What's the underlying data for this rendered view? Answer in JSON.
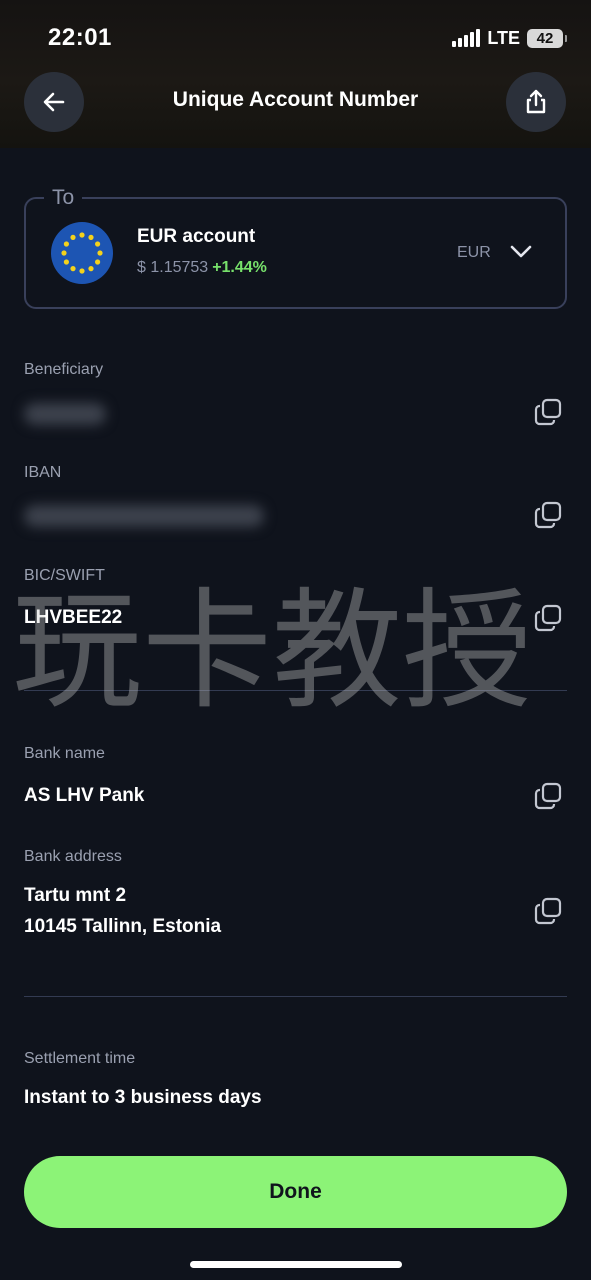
{
  "status_bar": {
    "time": "22:01",
    "network": "LTE",
    "battery": "42"
  },
  "header": {
    "title": "Unique Account Number"
  },
  "to_card": {
    "label": "To",
    "account_name": "EUR account",
    "rate": "$ 1.15753",
    "change": "+1.44%",
    "currency": "EUR"
  },
  "details": {
    "beneficiary_label": "Beneficiary",
    "iban_label": "IBAN",
    "bic_label": "BIC/SWIFT",
    "bic_value": "LHVBEE22",
    "bank_name_label": "Bank name",
    "bank_name_value": "AS LHV Pank",
    "bank_address_label": "Bank address",
    "bank_address_line1": "Tartu mnt 2",
    "bank_address_line2": "10145 Tallinn, Estonia",
    "settlement_label": "Settlement time",
    "settlement_value": "Instant to 3 business days"
  },
  "watermark": "玩卡教授",
  "actions": {
    "done_label": "Done"
  },
  "colors": {
    "accent_green": "#8cf377",
    "positive_change": "#77e16b",
    "background": "#0f131c"
  },
  "icons": {
    "back": "arrow-left-icon",
    "share": "share-icon",
    "flag": "eu-flag-icon",
    "dropdown": "chevron-down-icon",
    "copy": "copy-icon"
  }
}
